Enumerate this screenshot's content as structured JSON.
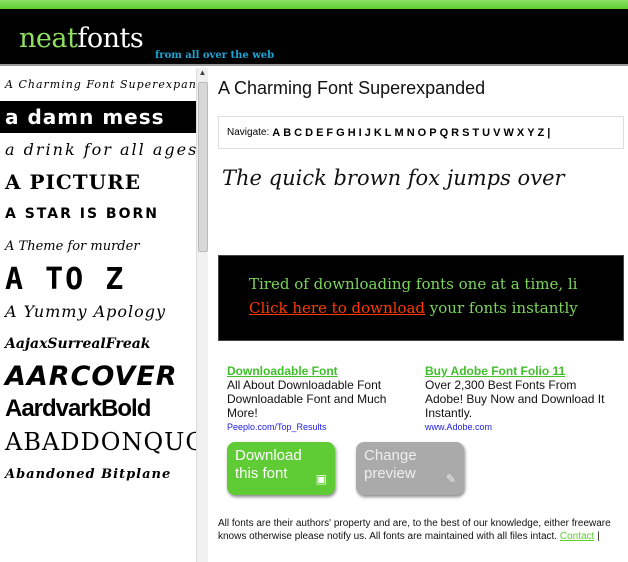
{
  "header": {
    "logo_a": "neat",
    "logo_b": "fonts",
    "tagline": "from all over the web"
  },
  "font_list": [
    "A Charming Font Superexpanded",
    "a damn mess",
    "a drink for all ages",
    "A PICTURE",
    "A STAR IS BORN",
    "A Theme for murder",
    "A TO Z",
    "A Yummy Apology",
    "AajaxSurrealFreak",
    "AARCOVER",
    "AardvarkBold",
    "ABADDONQUOT",
    "Abandoned Bitplane"
  ],
  "main": {
    "title": "A Charming Font Superexpanded",
    "navigate_label": "Navigate:",
    "letters": [
      "A",
      "B",
      "C",
      "D",
      "E",
      "F",
      "G",
      "H",
      "I",
      "J",
      "K",
      "L",
      "M",
      "N",
      "O",
      "P",
      "Q",
      "R",
      "S",
      "T",
      "U",
      "V",
      "W",
      "X",
      "Y",
      "Z",
      "|"
    ],
    "preview_text": "The quick brown fox jumps over",
    "promo_line1": "Tired of downloading fonts one at a time, li",
    "promo_link": "Click here to download",
    "promo_rest": " your fonts instantly",
    "ads": [
      {
        "title": "Downloadable Font",
        "body": "All About Downloadable Font Downloadable Font and Much More!",
        "url": "Peeplo.com/Top_Results"
      },
      {
        "title": "Buy Adobe Font Folio 11",
        "body": "Over 2,300 Best Fonts From Adobe! Buy Now and Download It Instantly.",
        "url": "www.Adobe.com"
      }
    ],
    "download_button": "Download this font",
    "change_button": "Change preview",
    "footer_line1": "All fonts are their authors' property and are, to the best of our knowledge, either freeware",
    "footer_line2": "knows otherwise please notify us. All fonts are maintained with all files intact. ",
    "footer_contact": "Contact",
    "footer_sep": " | "
  },
  "colors": {
    "brand_green": "#8fe060",
    "promo_link": "#ff3a00",
    "tagline": "#19a6d6"
  }
}
